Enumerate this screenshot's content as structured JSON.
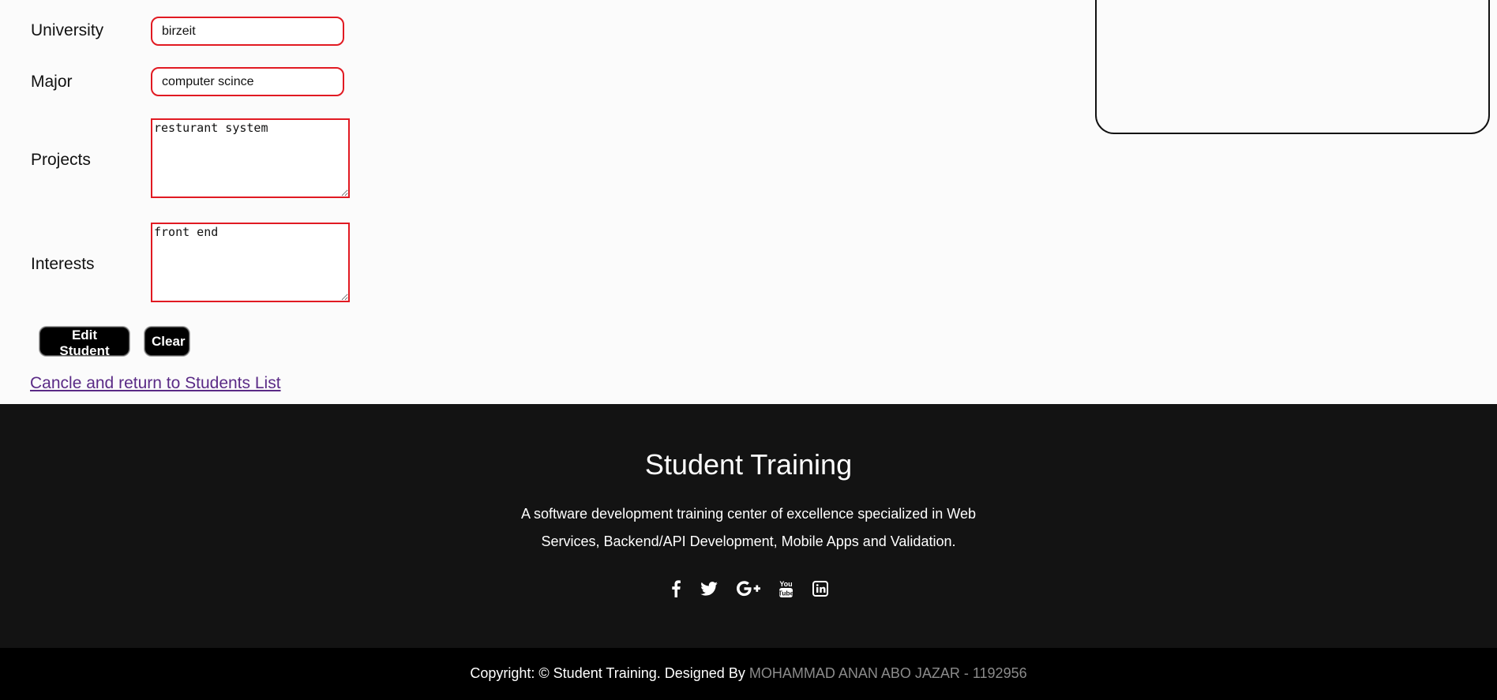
{
  "form": {
    "university": {
      "label": "University",
      "value": "birzeit"
    },
    "major": {
      "label": "Major",
      "value": "computer scince"
    },
    "projects": {
      "label": "Projects",
      "value": "resturant system"
    },
    "interests": {
      "label": "Interests",
      "value": "front end"
    }
  },
  "actions": {
    "edit_label": "Edit Student",
    "clear_label": "Clear",
    "return_link": "Cancle and return to Students List"
  },
  "footer": {
    "title": "Student Training",
    "description": "A software development training center of excellence specialized in Web Services, Backend/API Development, Mobile Apps and Validation.",
    "social": [
      "facebook-icon",
      "twitter-icon",
      "google-plus-icon",
      "youtube-icon",
      "linkedin-icon"
    ]
  },
  "copyright": {
    "prefix": "Copyright: © Student Training. Designed By ",
    "designer": "MOHAMMAD ANAN ABO JAZAR - 1192956"
  },
  "colors": {
    "input_border": "#e11a22",
    "footer_bg": "#131313",
    "copyright_bg": "#000000",
    "link": "#5a2a86"
  }
}
